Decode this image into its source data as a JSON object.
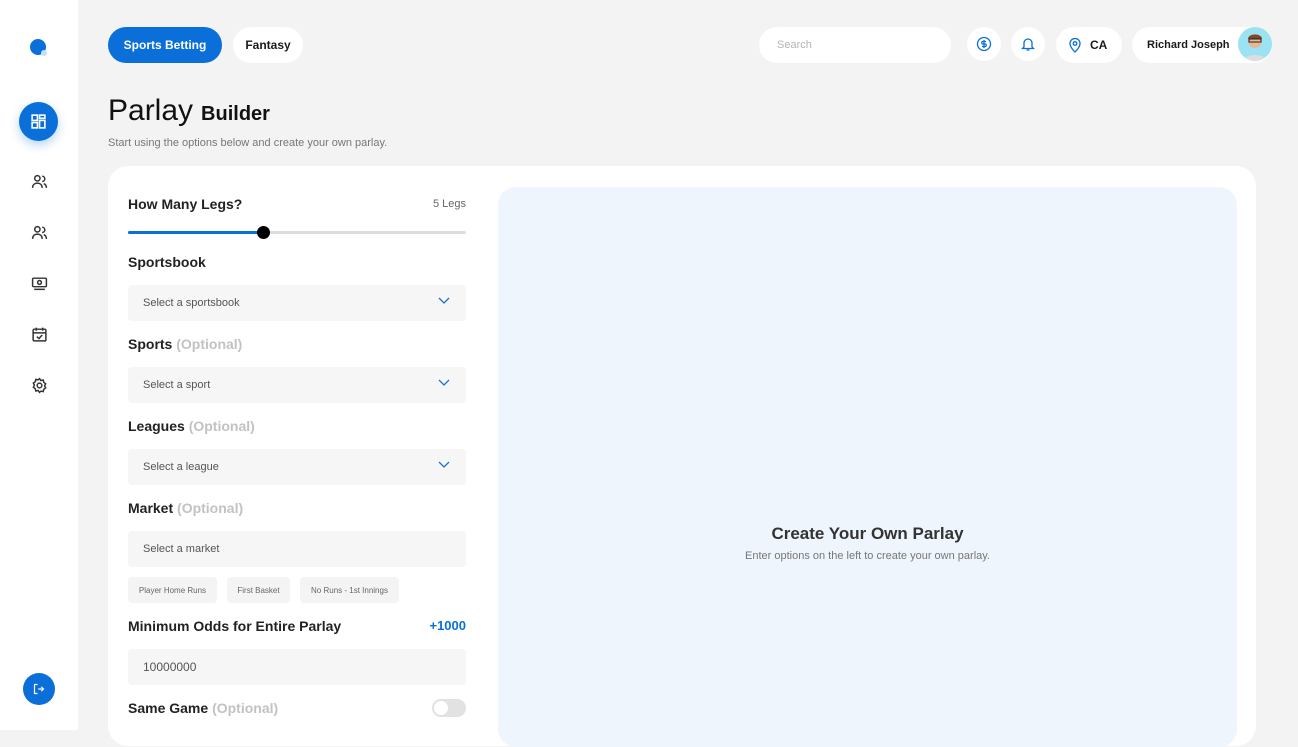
{
  "sidebar": {
    "items": [
      "dashboard",
      "users",
      "team",
      "payments",
      "calendar",
      "settings"
    ],
    "logout": "logout"
  },
  "header": {
    "tabs": [
      {
        "label": "Sports Betting",
        "active": true
      },
      {
        "label": "Fantasy",
        "active": false
      }
    ],
    "search_placeholder": "Search",
    "location": "CA",
    "user_name": "Richard Joseph"
  },
  "page": {
    "title": "Parlay",
    "title_suffix": "Builder",
    "subtitle": "Start using the options below and create your own parlay."
  },
  "form": {
    "legs": {
      "label": "How Many Legs?",
      "value_text": "5 Legs",
      "value": 5,
      "fill_fraction": 0.4
    },
    "sportsbook": {
      "label": "Sportsbook",
      "placeholder": "Select a sportsbook"
    },
    "sports": {
      "label": "Sports",
      "optional": "(Optional)",
      "placeholder": "Select a sport"
    },
    "leagues": {
      "label": "Leagues",
      "optional": "(Optional)",
      "placeholder": "Select a league"
    },
    "market": {
      "label": "Market",
      "optional": "(Optional)",
      "placeholder": "Select a market",
      "chips": [
        "Player Home Runs",
        "First Basket",
        "No Runs - 1st Innings"
      ]
    },
    "min_odds": {
      "label": "Minimum Odds for Entire Parlay",
      "odds": "+1000",
      "value": "10000000"
    },
    "same_game": {
      "label": "Same Game",
      "optional": "(Optional)",
      "enabled": false
    }
  },
  "empty_state": {
    "title": "Create Your Own Parlay",
    "text": "Enter options on the left to create your own parlay."
  },
  "colors": {
    "accent": "#0a6fd8",
    "panel": "#eef5fd"
  }
}
